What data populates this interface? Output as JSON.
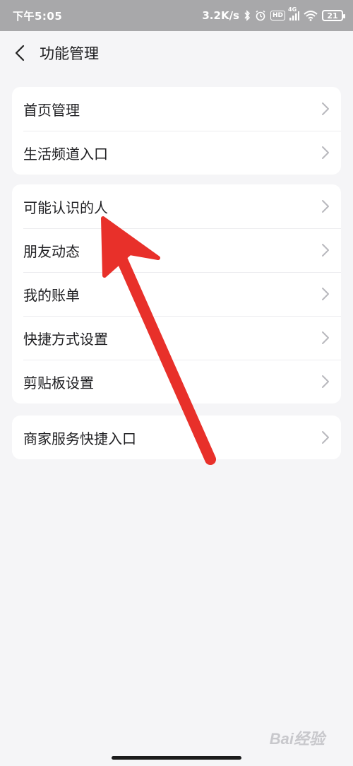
{
  "status_bar": {
    "time": "下午5:05",
    "net_speed": "3.2K/s",
    "signal_label": "4G",
    "hd_label": "HD",
    "battery": "21",
    "icons": [
      "bluetooth-icon",
      "alarm-icon",
      "hd-icon",
      "signal-icon",
      "wifi-icon",
      "battery-icon"
    ]
  },
  "header": {
    "title": "功能管理"
  },
  "groups": [
    {
      "items": [
        "首页管理",
        "生活频道入口"
      ]
    },
    {
      "items": [
        "可能认识的人",
        "朋友动态",
        "我的账单",
        "快捷方式设置",
        "剪贴板设置"
      ]
    },
    {
      "items": [
        "商家服务快捷入口"
      ]
    }
  ],
  "watermark": "Bai经验",
  "colors": {
    "annotation_arrow": "#e8302a",
    "status_bar_bg": "#a8a8aa",
    "page_bg": "#f5f5f7"
  }
}
